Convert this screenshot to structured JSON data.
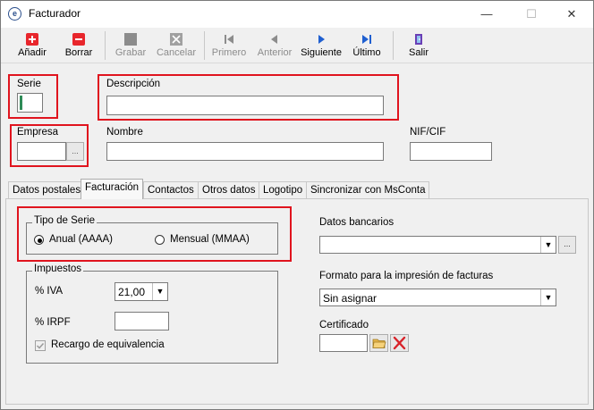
{
  "window": {
    "title": "Facturador",
    "icon_glyph": "e",
    "minimize_glyph": "—",
    "maximize_glyph": "☐",
    "close_glyph": "✕"
  },
  "toolbar": {
    "add_label": "Añadir",
    "delete_label": "Borrar",
    "save_label": "Grabar",
    "cancel_label": "Cancelar",
    "first_label": "Primero",
    "prev_label": "Anterior",
    "next_label": "Siguiente",
    "last_label": "Último",
    "exit_label": "Salir"
  },
  "form": {
    "serie_label": "Serie",
    "serie_value": "",
    "descripcion_label": "Descripción",
    "descripcion_value": "",
    "empresa_label": "Empresa",
    "empresa_value": "",
    "empresa_lookup_glyph": "...",
    "nombre_label": "Nombre",
    "nombre_value": "",
    "nif_label": "NIF/CIF",
    "nif_value": ""
  },
  "tabs": [
    {
      "label": "Datos postales"
    },
    {
      "label": "Facturación"
    },
    {
      "label": "Contactos"
    },
    {
      "label": "Otros datos"
    },
    {
      "label": "Logotipo"
    },
    {
      "label": "Sincronizar con MsConta"
    }
  ],
  "facturacion": {
    "tipo_serie_title": "Tipo de Serie",
    "radio_anual": "Anual (AAAA)",
    "radio_mensual": "Mensual (MMAA)",
    "impuestos_title": "Impuestos",
    "iva_label": "% IVA",
    "iva_value": "21,00",
    "irpf_label": "% IRPF",
    "irpf_value": "",
    "recargo_label": "Recargo de equivalencia",
    "datos_bancarios_label": "Datos bancarios",
    "datos_bancarios_value": "",
    "formato_label": "Formato para la impresión de facturas",
    "formato_value": "Sin asignar",
    "certificado_label": "Certificado",
    "certificado_value": "",
    "lookup_glyph": "..."
  },
  "colors": {
    "highlight_red": "#e0141e",
    "nav_blue": "#1f5fd0",
    "add_red": "#e8262c"
  }
}
